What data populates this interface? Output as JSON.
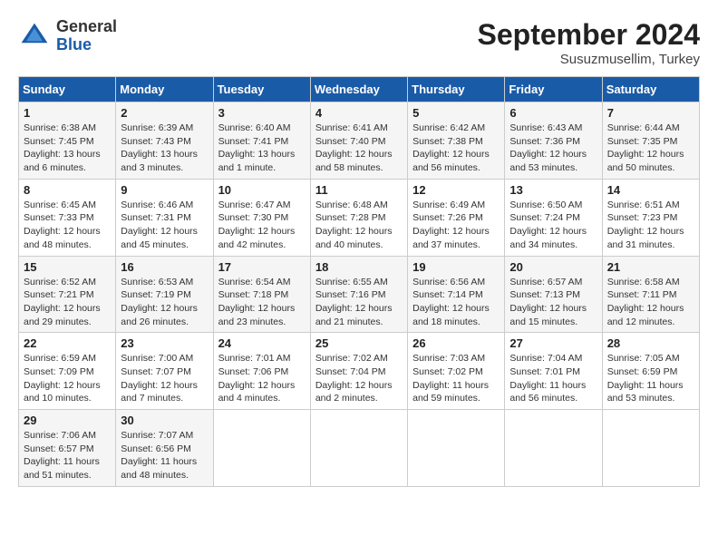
{
  "header": {
    "logo": {
      "general": "General",
      "blue": "Blue"
    },
    "title": "September 2024",
    "location": "Susuzmusellim, Turkey"
  },
  "days_of_week": [
    "Sunday",
    "Monday",
    "Tuesday",
    "Wednesday",
    "Thursday",
    "Friday",
    "Saturday"
  ],
  "weeks": [
    [
      {
        "day": "1",
        "sunrise": "6:38 AM",
        "sunset": "7:45 PM",
        "daylight": "13 hours and 6 minutes."
      },
      {
        "day": "2",
        "sunrise": "6:39 AM",
        "sunset": "7:43 PM",
        "daylight": "13 hours and 3 minutes."
      },
      {
        "day": "3",
        "sunrise": "6:40 AM",
        "sunset": "7:41 PM",
        "daylight": "13 hours and 1 minute."
      },
      {
        "day": "4",
        "sunrise": "6:41 AM",
        "sunset": "7:40 PM",
        "daylight": "12 hours and 58 minutes."
      },
      {
        "day": "5",
        "sunrise": "6:42 AM",
        "sunset": "7:38 PM",
        "daylight": "12 hours and 56 minutes."
      },
      {
        "day": "6",
        "sunrise": "6:43 AM",
        "sunset": "7:36 PM",
        "daylight": "12 hours and 53 minutes."
      },
      {
        "day": "7",
        "sunrise": "6:44 AM",
        "sunset": "7:35 PM",
        "daylight": "12 hours and 50 minutes."
      }
    ],
    [
      {
        "day": "8",
        "sunrise": "6:45 AM",
        "sunset": "7:33 PM",
        "daylight": "12 hours and 48 minutes."
      },
      {
        "day": "9",
        "sunrise": "6:46 AM",
        "sunset": "7:31 PM",
        "daylight": "12 hours and 45 minutes."
      },
      {
        "day": "10",
        "sunrise": "6:47 AM",
        "sunset": "7:30 PM",
        "daylight": "12 hours and 42 minutes."
      },
      {
        "day": "11",
        "sunrise": "6:48 AM",
        "sunset": "7:28 PM",
        "daylight": "12 hours and 40 minutes."
      },
      {
        "day": "12",
        "sunrise": "6:49 AM",
        "sunset": "7:26 PM",
        "daylight": "12 hours and 37 minutes."
      },
      {
        "day": "13",
        "sunrise": "6:50 AM",
        "sunset": "7:24 PM",
        "daylight": "12 hours and 34 minutes."
      },
      {
        "day": "14",
        "sunrise": "6:51 AM",
        "sunset": "7:23 PM",
        "daylight": "12 hours and 31 minutes."
      }
    ],
    [
      {
        "day": "15",
        "sunrise": "6:52 AM",
        "sunset": "7:21 PM",
        "daylight": "12 hours and 29 minutes."
      },
      {
        "day": "16",
        "sunrise": "6:53 AM",
        "sunset": "7:19 PM",
        "daylight": "12 hours and 26 minutes."
      },
      {
        "day": "17",
        "sunrise": "6:54 AM",
        "sunset": "7:18 PM",
        "daylight": "12 hours and 23 minutes."
      },
      {
        "day": "18",
        "sunrise": "6:55 AM",
        "sunset": "7:16 PM",
        "daylight": "12 hours and 21 minutes."
      },
      {
        "day": "19",
        "sunrise": "6:56 AM",
        "sunset": "7:14 PM",
        "daylight": "12 hours and 18 minutes."
      },
      {
        "day": "20",
        "sunrise": "6:57 AM",
        "sunset": "7:13 PM",
        "daylight": "12 hours and 15 minutes."
      },
      {
        "day": "21",
        "sunrise": "6:58 AM",
        "sunset": "7:11 PM",
        "daylight": "12 hours and 12 minutes."
      }
    ],
    [
      {
        "day": "22",
        "sunrise": "6:59 AM",
        "sunset": "7:09 PM",
        "daylight": "12 hours and 10 minutes."
      },
      {
        "day": "23",
        "sunrise": "7:00 AM",
        "sunset": "7:07 PM",
        "daylight": "12 hours and 7 minutes."
      },
      {
        "day": "24",
        "sunrise": "7:01 AM",
        "sunset": "7:06 PM",
        "daylight": "12 hours and 4 minutes."
      },
      {
        "day": "25",
        "sunrise": "7:02 AM",
        "sunset": "7:04 PM",
        "daylight": "12 hours and 2 minutes."
      },
      {
        "day": "26",
        "sunrise": "7:03 AM",
        "sunset": "7:02 PM",
        "daylight": "11 hours and 59 minutes."
      },
      {
        "day": "27",
        "sunrise": "7:04 AM",
        "sunset": "7:01 PM",
        "daylight": "11 hours and 56 minutes."
      },
      {
        "day": "28",
        "sunrise": "7:05 AM",
        "sunset": "6:59 PM",
        "daylight": "11 hours and 53 minutes."
      }
    ],
    [
      {
        "day": "29",
        "sunrise": "7:06 AM",
        "sunset": "6:57 PM",
        "daylight": "11 hours and 51 minutes."
      },
      {
        "day": "30",
        "sunrise": "7:07 AM",
        "sunset": "6:56 PM",
        "daylight": "11 hours and 48 minutes."
      },
      null,
      null,
      null,
      null,
      null
    ]
  ]
}
